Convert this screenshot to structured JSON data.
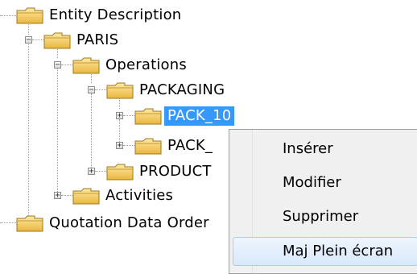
{
  "tree": {
    "nodes": [
      {
        "label": "Entity Description",
        "expander": "",
        "selected": false
      },
      {
        "label": "PARIS",
        "expander": "−",
        "selected": false
      },
      {
        "label": "Operations",
        "expander": "−",
        "selected": false
      },
      {
        "label": "PACKAGING",
        "expander": "−",
        "selected": false
      },
      {
        "label": "PACK_10",
        "expander": "+",
        "selected": true
      },
      {
        "label": "PACK_",
        "expander": "+",
        "selected": false
      },
      {
        "label": "PRODUCT",
        "expander": "+",
        "selected": false
      },
      {
        "label": "Activities",
        "expander": "+",
        "selected": false
      },
      {
        "label": "Quotation Data Order",
        "expander": "",
        "selected": false
      }
    ]
  },
  "context_menu": {
    "items": [
      {
        "label": "Insérer"
      },
      {
        "label": "Modifier"
      },
      {
        "label": "Supprimer"
      },
      {
        "label": "Maj Plein écran",
        "hover": true
      }
    ]
  },
  "colors": {
    "selection": "#3399ff",
    "folder": "#f2cf5b",
    "menu_background": "#f0f0f0",
    "menu_hover": "#d9e9fb"
  },
  "icons": {
    "folder": "folder-icon",
    "expand": "plus-box-icon",
    "collapse": "minus-box-icon"
  }
}
